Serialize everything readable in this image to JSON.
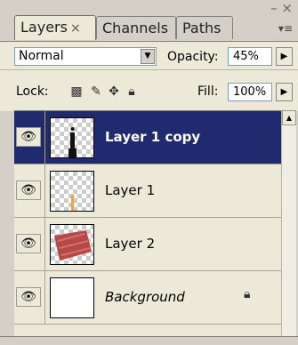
{
  "tabs": [
    {
      "label": "Layers",
      "close": "×"
    },
    {
      "label": "Channels"
    },
    {
      "label": "Paths"
    }
  ],
  "panel_controls": {
    "minimize": "–",
    "close": "×",
    "menu": "▾≡"
  },
  "blend": {
    "mode": "Normal",
    "opacity_label": "Opacity:",
    "opacity_value": "45%"
  },
  "lock": {
    "label": "Lock:",
    "fill_label": "Fill:",
    "fill_value": "100%"
  },
  "layers": [
    {
      "name": "Layer 1 copy",
      "selected": true
    },
    {
      "name": "Layer 1",
      "selected": false
    },
    {
      "name": "Layer 2",
      "selected": false
    },
    {
      "name": "Background",
      "selected": false,
      "locked": true
    }
  ],
  "colors": {
    "selection": "#1f2b6e",
    "panel": "#ece9d8",
    "brush_red": "#b84848",
    "stroke_orange": "#e6a35a"
  }
}
